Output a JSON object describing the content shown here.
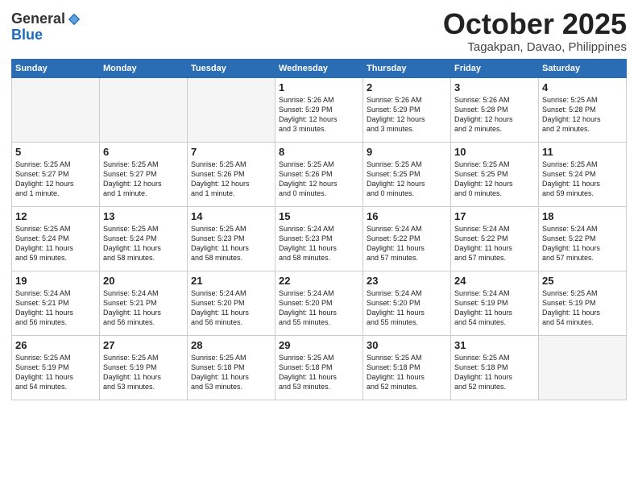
{
  "header": {
    "logo_general": "General",
    "logo_blue": "Blue",
    "month": "October 2025",
    "location": "Tagakpan, Davao, Philippines"
  },
  "weekdays": [
    "Sunday",
    "Monday",
    "Tuesday",
    "Wednesday",
    "Thursday",
    "Friday",
    "Saturday"
  ],
  "weeks": [
    [
      {
        "day": "",
        "text": ""
      },
      {
        "day": "",
        "text": ""
      },
      {
        "day": "",
        "text": ""
      },
      {
        "day": "1",
        "text": "Sunrise: 5:26 AM\nSunset: 5:29 PM\nDaylight: 12 hours\nand 3 minutes."
      },
      {
        "day": "2",
        "text": "Sunrise: 5:26 AM\nSunset: 5:29 PM\nDaylight: 12 hours\nand 3 minutes."
      },
      {
        "day": "3",
        "text": "Sunrise: 5:26 AM\nSunset: 5:28 PM\nDaylight: 12 hours\nand 2 minutes."
      },
      {
        "day": "4",
        "text": "Sunrise: 5:25 AM\nSunset: 5:28 PM\nDaylight: 12 hours\nand 2 minutes."
      }
    ],
    [
      {
        "day": "5",
        "text": "Sunrise: 5:25 AM\nSunset: 5:27 PM\nDaylight: 12 hours\nand 1 minute."
      },
      {
        "day": "6",
        "text": "Sunrise: 5:25 AM\nSunset: 5:27 PM\nDaylight: 12 hours\nand 1 minute."
      },
      {
        "day": "7",
        "text": "Sunrise: 5:25 AM\nSunset: 5:26 PM\nDaylight: 12 hours\nand 1 minute."
      },
      {
        "day": "8",
        "text": "Sunrise: 5:25 AM\nSunset: 5:26 PM\nDaylight: 12 hours\nand 0 minutes."
      },
      {
        "day": "9",
        "text": "Sunrise: 5:25 AM\nSunset: 5:25 PM\nDaylight: 12 hours\nand 0 minutes."
      },
      {
        "day": "10",
        "text": "Sunrise: 5:25 AM\nSunset: 5:25 PM\nDaylight: 12 hours\nand 0 minutes."
      },
      {
        "day": "11",
        "text": "Sunrise: 5:25 AM\nSunset: 5:24 PM\nDaylight: 11 hours\nand 59 minutes."
      }
    ],
    [
      {
        "day": "12",
        "text": "Sunrise: 5:25 AM\nSunset: 5:24 PM\nDaylight: 11 hours\nand 59 minutes."
      },
      {
        "day": "13",
        "text": "Sunrise: 5:25 AM\nSunset: 5:24 PM\nDaylight: 11 hours\nand 58 minutes."
      },
      {
        "day": "14",
        "text": "Sunrise: 5:25 AM\nSunset: 5:23 PM\nDaylight: 11 hours\nand 58 minutes."
      },
      {
        "day": "15",
        "text": "Sunrise: 5:24 AM\nSunset: 5:23 PM\nDaylight: 11 hours\nand 58 minutes."
      },
      {
        "day": "16",
        "text": "Sunrise: 5:24 AM\nSunset: 5:22 PM\nDaylight: 11 hours\nand 57 minutes."
      },
      {
        "day": "17",
        "text": "Sunrise: 5:24 AM\nSunset: 5:22 PM\nDaylight: 11 hours\nand 57 minutes."
      },
      {
        "day": "18",
        "text": "Sunrise: 5:24 AM\nSunset: 5:22 PM\nDaylight: 11 hours\nand 57 minutes."
      }
    ],
    [
      {
        "day": "19",
        "text": "Sunrise: 5:24 AM\nSunset: 5:21 PM\nDaylight: 11 hours\nand 56 minutes."
      },
      {
        "day": "20",
        "text": "Sunrise: 5:24 AM\nSunset: 5:21 PM\nDaylight: 11 hours\nand 56 minutes."
      },
      {
        "day": "21",
        "text": "Sunrise: 5:24 AM\nSunset: 5:20 PM\nDaylight: 11 hours\nand 56 minutes."
      },
      {
        "day": "22",
        "text": "Sunrise: 5:24 AM\nSunset: 5:20 PM\nDaylight: 11 hours\nand 55 minutes."
      },
      {
        "day": "23",
        "text": "Sunrise: 5:24 AM\nSunset: 5:20 PM\nDaylight: 11 hours\nand 55 minutes."
      },
      {
        "day": "24",
        "text": "Sunrise: 5:24 AM\nSunset: 5:19 PM\nDaylight: 11 hours\nand 54 minutes."
      },
      {
        "day": "25",
        "text": "Sunrise: 5:25 AM\nSunset: 5:19 PM\nDaylight: 11 hours\nand 54 minutes."
      }
    ],
    [
      {
        "day": "26",
        "text": "Sunrise: 5:25 AM\nSunset: 5:19 PM\nDaylight: 11 hours\nand 54 minutes."
      },
      {
        "day": "27",
        "text": "Sunrise: 5:25 AM\nSunset: 5:19 PM\nDaylight: 11 hours\nand 53 minutes."
      },
      {
        "day": "28",
        "text": "Sunrise: 5:25 AM\nSunset: 5:18 PM\nDaylight: 11 hours\nand 53 minutes."
      },
      {
        "day": "29",
        "text": "Sunrise: 5:25 AM\nSunset: 5:18 PM\nDaylight: 11 hours\nand 53 minutes."
      },
      {
        "day": "30",
        "text": "Sunrise: 5:25 AM\nSunset: 5:18 PM\nDaylight: 11 hours\nand 52 minutes."
      },
      {
        "day": "31",
        "text": "Sunrise: 5:25 AM\nSunset: 5:18 PM\nDaylight: 11 hours\nand 52 minutes."
      },
      {
        "day": "",
        "text": ""
      }
    ]
  ]
}
